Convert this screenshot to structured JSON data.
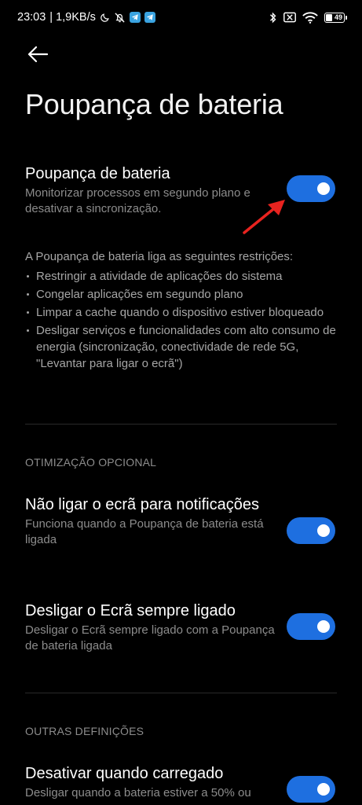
{
  "status_bar": {
    "time": "23:03",
    "speed": "| 1,9KB/s",
    "battery_level": "49"
  },
  "page": {
    "title": "Poupança de bateria"
  },
  "main_setting": {
    "title": "Poupança de bateria",
    "subtitle": "Monitorizar processos em segundo plano e desativar a sincronização.",
    "enabled": true
  },
  "info": {
    "intro": "A Poupança de bateria liga as seguintes restrições:",
    "items": [
      "Restringir a atividade de aplicações do sistema",
      "Congelar aplicações em segundo plano",
      "Limpar a cache quando o dispositivo estiver bloqueado",
      "Desligar serviços e funcionalidades com alto consumo de energia (sincronização, conectividade de rede 5G, \"Levantar para ligar o ecrã\")"
    ]
  },
  "sections": {
    "optional": "OTIMIZAÇÃO OPCIONAL",
    "other": "OUTRAS DEFINIÇÕES"
  },
  "optional_settings": [
    {
      "title": "Não ligar o ecrã para notificações",
      "subtitle": "Funciona quando a Poupança de bateria está ligada",
      "enabled": true
    },
    {
      "title": "Desligar o Ecrã sempre ligado",
      "subtitle": "Desligar o Ecrã sempre ligado com a Poupança de bateria ligada",
      "enabled": true
    }
  ],
  "other_settings": [
    {
      "title": "Desativar quando carregado",
      "subtitle": "Desligar quando a bateria estiver a 50% ou",
      "enabled": true
    }
  ],
  "colors": {
    "background": "#000000",
    "accent": "#1e6fe0",
    "annotation_arrow": "#e8231f"
  }
}
